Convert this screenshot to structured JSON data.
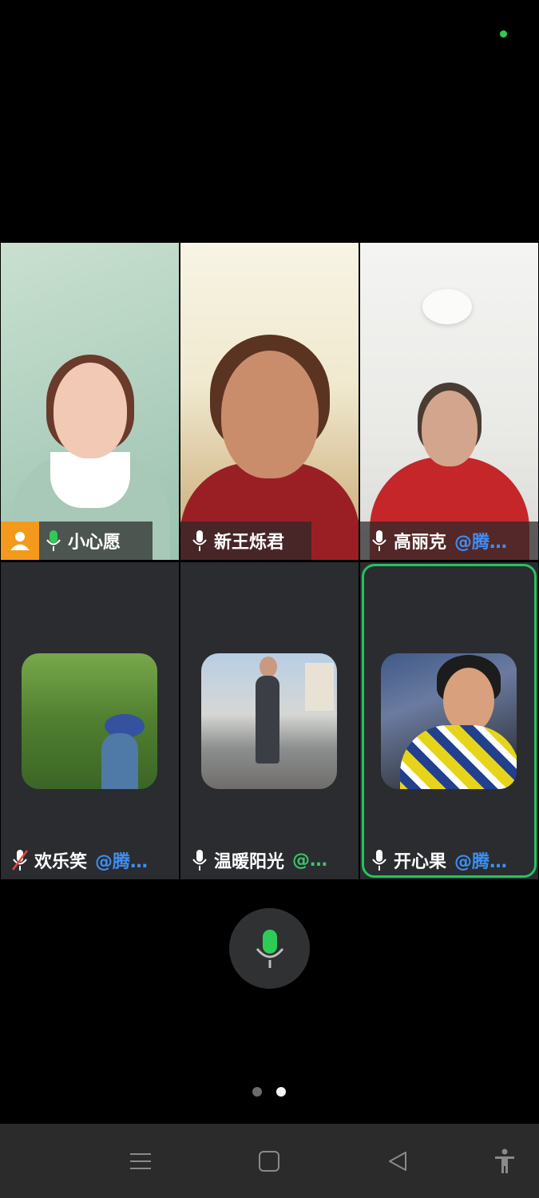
{
  "participants": [
    {
      "name": "小心愿",
      "org": "",
      "host": true,
      "mic": "active",
      "speaking": false
    },
    {
      "name": "新王烁君",
      "org": "",
      "host": false,
      "mic": "on",
      "speaking": false
    },
    {
      "name": "高丽克",
      "org": "@腾…",
      "host": false,
      "mic": "on",
      "speaking": false
    },
    {
      "name": "欢乐笑",
      "org": "@腾…",
      "host": false,
      "mic": "muted",
      "speaking": false
    },
    {
      "name": "温暖阳光",
      "org": "@…",
      "host": false,
      "mic": "on",
      "speaking": false
    },
    {
      "name": "开心果",
      "org": "@腾…",
      "host": false,
      "mic": "on",
      "speaking": true
    }
  ],
  "controls": {
    "mic_button_icon": "microphone-icon",
    "accent": "#25c35e"
  },
  "pager": {
    "pages": 2,
    "current": 2
  },
  "navbar": {
    "icons": [
      "menu-icon",
      "home-square-icon",
      "back-triangle-icon",
      "accessibility-icon"
    ]
  },
  "colors": {
    "host_badge": "#f39a1d",
    "org_blue": "#3d8ff5",
    "org_green": "#3dc36a",
    "mic_green": "#2ecc55"
  }
}
